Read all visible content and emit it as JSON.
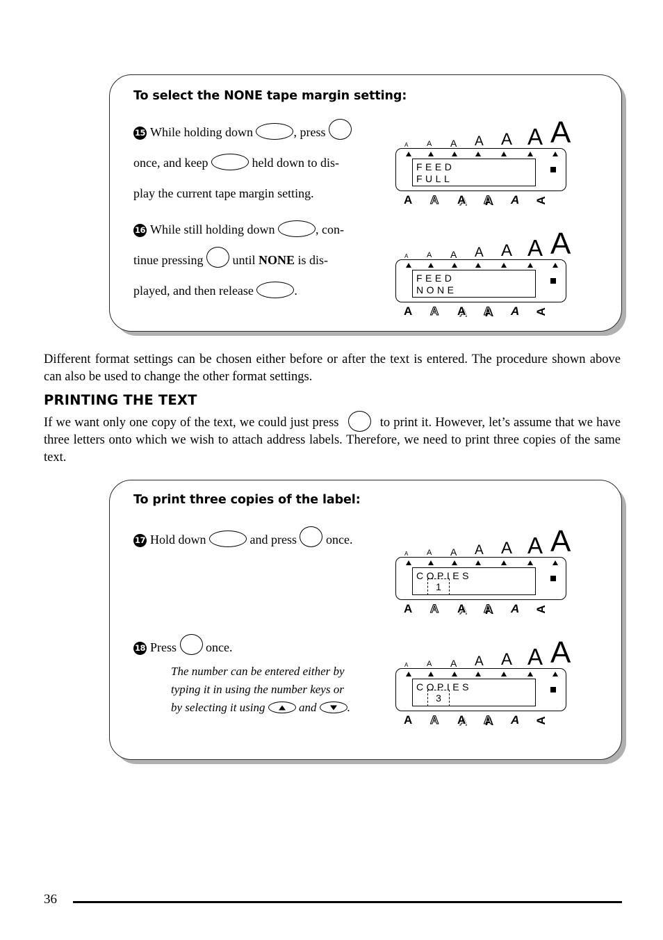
{
  "page": {
    "number": "36"
  },
  "panel_1": {
    "title": "To select the NONE tape margin setting:",
    "steps": [
      {
        "number": "15",
        "segments": [
          "While holding down",
          ", press",
          "once, and keep",
          "held down to dis-",
          "play the current tape margin setting."
        ]
      },
      {
        "number": "16",
        "segments": [
          "While still holding down",
          ", con-",
          "tinue pressing",
          "until",
          "NONE",
          "is dis-",
          "played, and then release",
          "."
        ]
      }
    ],
    "lcd_1": {
      "line1": "FEED",
      "line2": "FULL",
      "size_marks": 7,
      "style_labels": [
        "A",
        "A",
        "A",
        "A",
        "A",
        "A"
      ]
    },
    "lcd_2": {
      "line1": "FEED",
      "line2": "NONE",
      "size_marks": 7,
      "style_labels": [
        "A",
        "A",
        "A",
        "A",
        "A",
        "A"
      ]
    }
  },
  "body": {
    "paragraph_1": "Different format settings can be chosen either before or after the text is entered. The procedure shown above can also be used to change the other format settings.",
    "heading": "PRINTING THE TEXT",
    "paragraph_2_a": "If we want only one copy of the text, we could just press",
    "paragraph_2_b": "to print it. However, let’s assume that we have three letters onto which we wish to attach address labels. Therefore, we need to print three copies of the same text."
  },
  "panel_2": {
    "title": "To print three copies of the label:",
    "steps": [
      {
        "number": "17",
        "segments": [
          "Hold down",
          "and press",
          "once."
        ]
      },
      {
        "number": "18",
        "segments": [
          "Press",
          "once."
        ]
      }
    ],
    "note": {
      "line1": "The number can be entered either by",
      "line2": "typing it in using the number keys or",
      "line3_a": "by selecting it using",
      "line3_b": "and",
      "line3_c": "."
    },
    "lcd_1": {
      "line1": "COPIES",
      "value": "1",
      "flashing": true,
      "size_marks": 7,
      "style_labels": [
        "A",
        "A",
        "A",
        "A",
        "A",
        "A"
      ]
    },
    "lcd_2": {
      "line1": "COPIES",
      "value": "3",
      "flashing": true,
      "size_marks": 7,
      "style_labels": [
        "A",
        "A",
        "A",
        "A",
        "A",
        "A"
      ]
    }
  },
  "colors": {
    "ink": "#000000",
    "panel_border": "#2b2b2b",
    "panel_shadow": "#b0b0b0",
    "paper": "#ffffff"
  }
}
